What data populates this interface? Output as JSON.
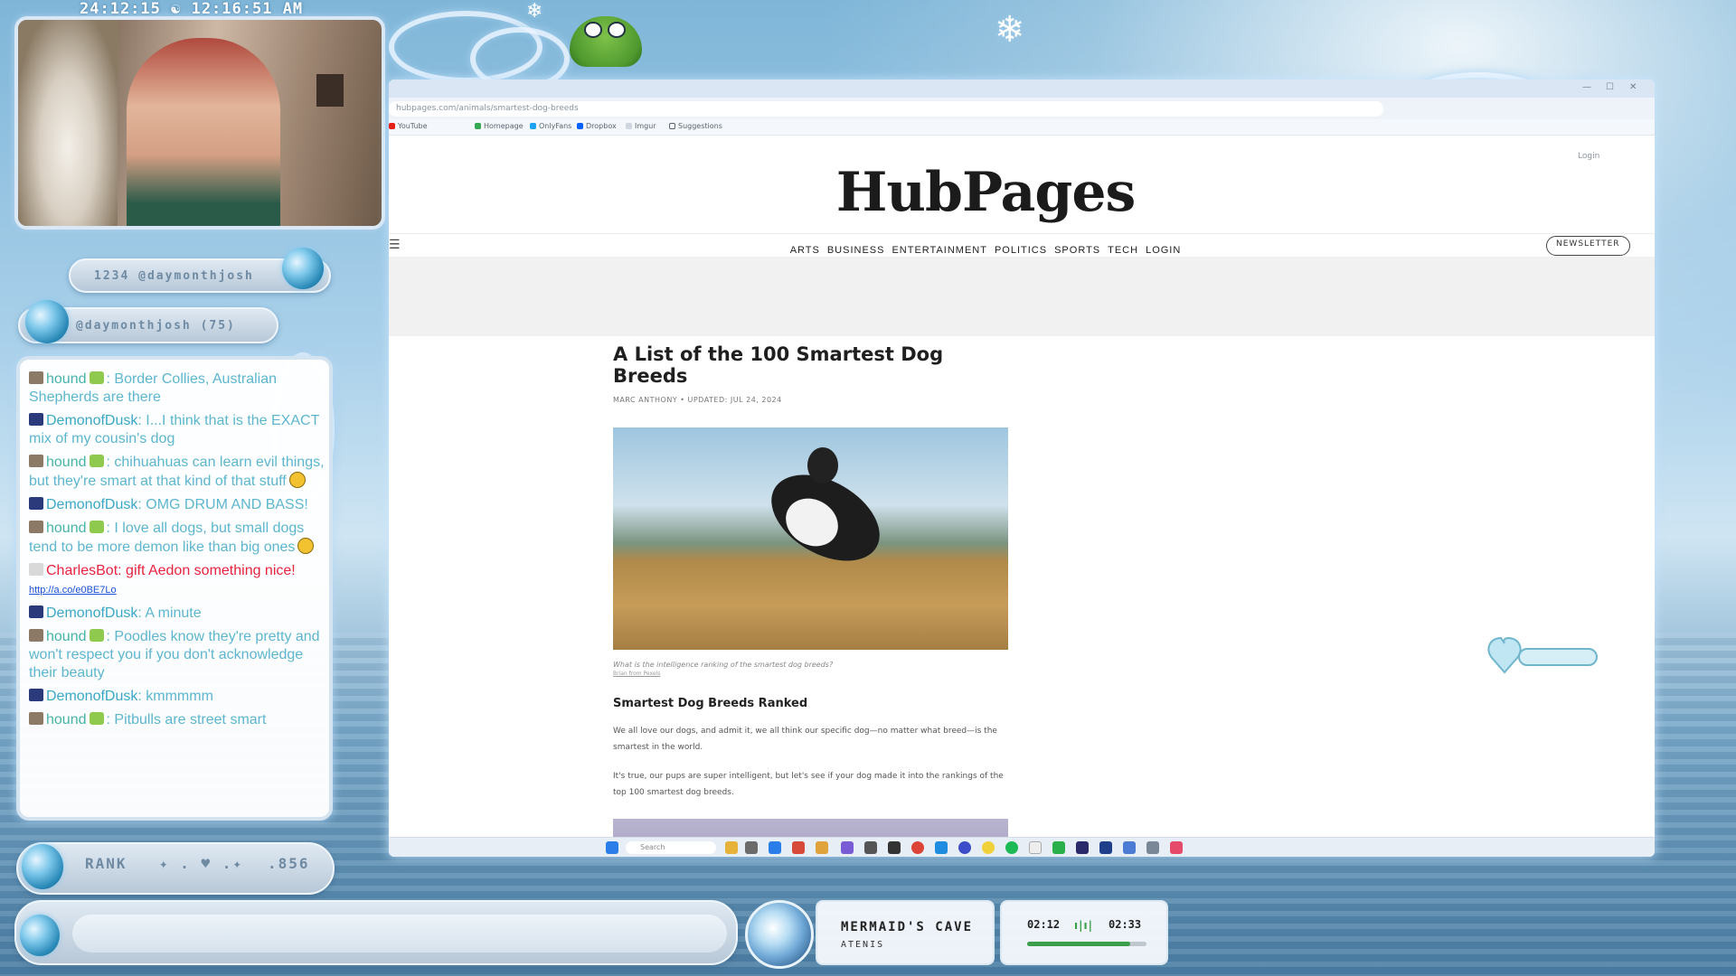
{
  "overlay": {
    "clock": "24:12:15 ☯ 12:16:51 AM",
    "top_donor": "1234 @daymonthjosh",
    "follower": "@daymonthjosh (75)",
    "rank_label": "RANK",
    "rank_value": ".856"
  },
  "chat": {
    "messages": [
      {
        "user": "hound",
        "text": ": Border Collies, Australian Shepherds are there",
        "user_color": "#45b4a8"
      },
      {
        "user": "DemonofDusk",
        "text": ": I...I think that is the EXACT mix of my cousin's dog",
        "user_color": "#3aa7c4"
      },
      {
        "user": "hound",
        "text": ": chihuahuas can learn evil things, but they're smart at that kind of that stuff",
        "user_color": "#45b4a8"
      },
      {
        "user": "DemonofDusk",
        "text": ": OMG DRUM AND BASS!",
        "user_color": "#3aa7c4"
      },
      {
        "user": "hound",
        "text": ": I love all dogs, but small dogs tend to be more demon like than big ones",
        "user_color": "#45b4a8"
      },
      {
        "user": "CharlesBot",
        "text": ": gift Aedon something nice!",
        "link": "http://a.co/e0BE7Lo",
        "user_color": "#e8233e"
      },
      {
        "user": "DemonofDusk",
        "text": ": A minute",
        "user_color": "#3aa7c4"
      },
      {
        "user": "hound",
        "text": ": Poodles know they're pretty and won't respect you if you don't acknowledge their beauty",
        "user_color": "#45b4a8"
      },
      {
        "user": "DemonofDusk",
        "text": ": kmmmmm",
        "user_color": "#3aa7c4"
      },
      {
        "user": "hound",
        "text": ": Pitbulls are street smart",
        "user_color": "#45b4a8"
      }
    ]
  },
  "browser": {
    "address": "hubpages.com/animals/smartest-dog-breeds",
    "bookmarks": [
      "YouTube",
      "Homepage",
      "OnlyFans",
      "Dropbox",
      "Imgur",
      "Suggestions"
    ],
    "login_top": "Login",
    "logo": "HubPages",
    "nav": [
      "ARTS",
      "BUSINESS",
      "ENTERTAINMENT",
      "POLITICS",
      "SPORTS",
      "TECH",
      "LOGIN"
    ],
    "newsletter": "NEWSLETTER",
    "article": {
      "title": "A List of the 100 Smartest Dog Breeds",
      "byline": "MARC ANTHONY • UPDATED: JUL 24, 2024",
      "caption": "What is the intelligence ranking of the smartest dog breeds?",
      "credit": "Brian from Pexels",
      "subhead": "Smartest Dog Breeds Ranked",
      "para1": "We all love our dogs, and admit it, we all think our specific dog—no matter what breed—is the smartest in the world.",
      "para2": "It's true, our pups are super intelligent, but let's see if your dog made it into the rankings of the top 100 smartest dog breeds."
    },
    "taskbar_search": "Search"
  },
  "music": {
    "title": "MERMAID'S CAVE",
    "artist": "ATENIS",
    "elapsed": "02:12",
    "total": "02:33",
    "progress": 0.862
  },
  "colors": {
    "chat_blue": "#5db6ce",
    "chat_red": "#e8233e",
    "progress_green": "#3a9e4a"
  }
}
